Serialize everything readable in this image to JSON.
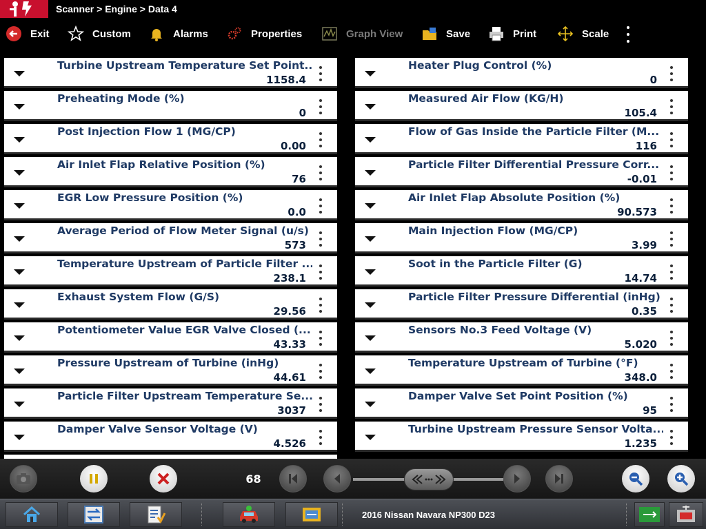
{
  "title": {
    "breadcrumb": "Scanner > Engine > Data 4"
  },
  "toolbar": {
    "exit": "Exit",
    "custom": "Custom",
    "alarms": "Alarms",
    "properties": "Properties",
    "graph_view": "Graph View",
    "save": "Save",
    "print": "Print",
    "scale": "Scale"
  },
  "left_rows": [
    {
      "label": "Turbine Upstream Temperature Set Point...",
      "value": "1158.4"
    },
    {
      "label": "Preheating Mode (%)",
      "value": "0"
    },
    {
      "label": "Post Injection Flow 1 (MG/CP)",
      "value": "0.00"
    },
    {
      "label": "Air Inlet Flap Relative Position (%)",
      "value": "76"
    },
    {
      "label": "EGR Low Pressure Position (%)",
      "value": "0.0"
    },
    {
      "label": "Average Period of Flow Meter Signal (u/s)",
      "value": "573"
    },
    {
      "label": "Temperature Upstream of Particle Filter ...",
      "value": "238.1"
    },
    {
      "label": "Exhaust System Flow (G/S)",
      "value": "29.56"
    },
    {
      "label": "Potentiometer Value EGR Valve Closed (...",
      "value": "43.33"
    },
    {
      "label": "Pressure Upstream of Turbine (inHg)",
      "value": "44.61"
    },
    {
      "label": "Particle Filter Upstream Temperature Se...",
      "value": "3037"
    },
    {
      "label": "Damper Valve Sensor Voltage (V)",
      "value": "4.526"
    }
  ],
  "right_rows": [
    {
      "label": "Heater Plug Control (%)",
      "value": "0"
    },
    {
      "label": "Measured Air Flow (KG/H)",
      "value": "105.4"
    },
    {
      "label": "Flow of Gas Inside the Particle Filter (M...",
      "value": "116"
    },
    {
      "label": "Particle Filter Differential Pressure Corr...",
      "value": "-0.01"
    },
    {
      "label": "Air Inlet Flap Absolute Position (%)",
      "value": "90.573"
    },
    {
      "label": "Main Injection Flow (MG/CP)",
      "value": "3.99"
    },
    {
      "label": "Soot in the Particle Filter (G)",
      "value": "14.74"
    },
    {
      "label": "Particle Filter Pressure Differential (inHg)",
      "value": "0.35"
    },
    {
      "label": "Sensors No.3 Feed Voltage (V)",
      "value": "5.020"
    },
    {
      "label": "Temperature Upstream of Turbine (°F)",
      "value": "348.0"
    },
    {
      "label": "Damper Valve Set Point Position (%)",
      "value": "95"
    },
    {
      "label": "Turbine Upstream Pressure Sensor Volta...",
      "value": "1.235"
    }
  ],
  "playback": {
    "frame_counter": "68"
  },
  "taskbar": {
    "vehicle": "2016 Nissan Navara NP300 D23"
  },
  "colors": {
    "brand_red": "#c8102e",
    "label_blue": "#1f3a64",
    "value_navy": "#0b1f3a"
  }
}
